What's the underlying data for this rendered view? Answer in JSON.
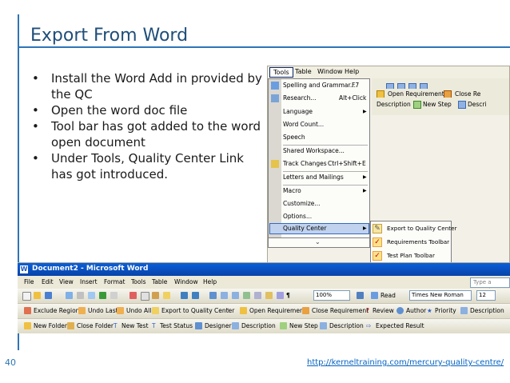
{
  "slide": {
    "title": "Export From Word",
    "bullets": [
      "Install the Word Add in provided by the QC",
      "Open the word doc file",
      "Tool bar has got added to the word open document",
      "Under Tools, Quality Center Link has got introduced."
    ],
    "slide_number": "40",
    "footer_link": "http://kerneltraining.com/mercury-quality-centre/"
  },
  "menu_shot": {
    "menubar": [
      "Tools",
      "Table",
      "Window",
      "Help"
    ],
    "tools_menu": [
      {
        "label": "Spelling and Grammar...",
        "shortcut": "F7"
      },
      {
        "label": "Research...",
        "shortcut": "Alt+Click"
      },
      {
        "label": "Language",
        "submenu": true
      },
      {
        "label": "Word Count..."
      },
      {
        "label": "Speech"
      },
      {
        "label": "Shared Workspace..."
      },
      {
        "label": "Track Changes",
        "shortcut": "Ctrl+Shift+E"
      },
      {
        "label": "Letters and Mailings",
        "submenu": true
      },
      {
        "label": "Macro",
        "submenu": true
      },
      {
        "label": "Customize..."
      },
      {
        "label": "Options..."
      },
      {
        "label": "Quality Center",
        "submenu": true
      }
    ],
    "submenu": [
      {
        "label": "Export to Quality Center",
        "checked": false
      },
      {
        "label": "Requirements Toolbar",
        "checked": true
      },
      {
        "label": "Test Plan Toolbar",
        "checked": true
      }
    ],
    "bg_toolbar1": [
      "Open Requirement",
      "Close Re"
    ],
    "bg_toolbar2": [
      "Description",
      "New Step",
      "Descri"
    ]
  },
  "word_shot": {
    "window_title": "Document2 - Microsoft Word",
    "menubar": [
      "File",
      "Edit",
      "View",
      "Insert",
      "Format",
      "Tools",
      "Table",
      "Window",
      "Help"
    ],
    "help_placeholder": "Type a questio",
    "std_zoom": "100%",
    "std_read": "Read",
    "font_name": "Times New Roman",
    "font_size": "12",
    "toolbar_export": [
      "Exclude Region",
      "Undo Last",
      "Undo All",
      "Export to Quality Center"
    ],
    "toolbar_req": [
      "Open Requirement",
      "Close Requirement",
      "Review",
      "Author",
      "Priority",
      "Description"
    ],
    "toolbar_test": [
      "New Folder",
      "Close Folder",
      "New Test",
      "Test Status",
      "Designer",
      "Description",
      "New Step",
      "Description",
      "Expected Result"
    ]
  },
  "colors": {
    "title": "#1f4e79",
    "accent": "#2e75b6",
    "link": "#0563c1",
    "highlight": "#c1d2ee"
  }
}
